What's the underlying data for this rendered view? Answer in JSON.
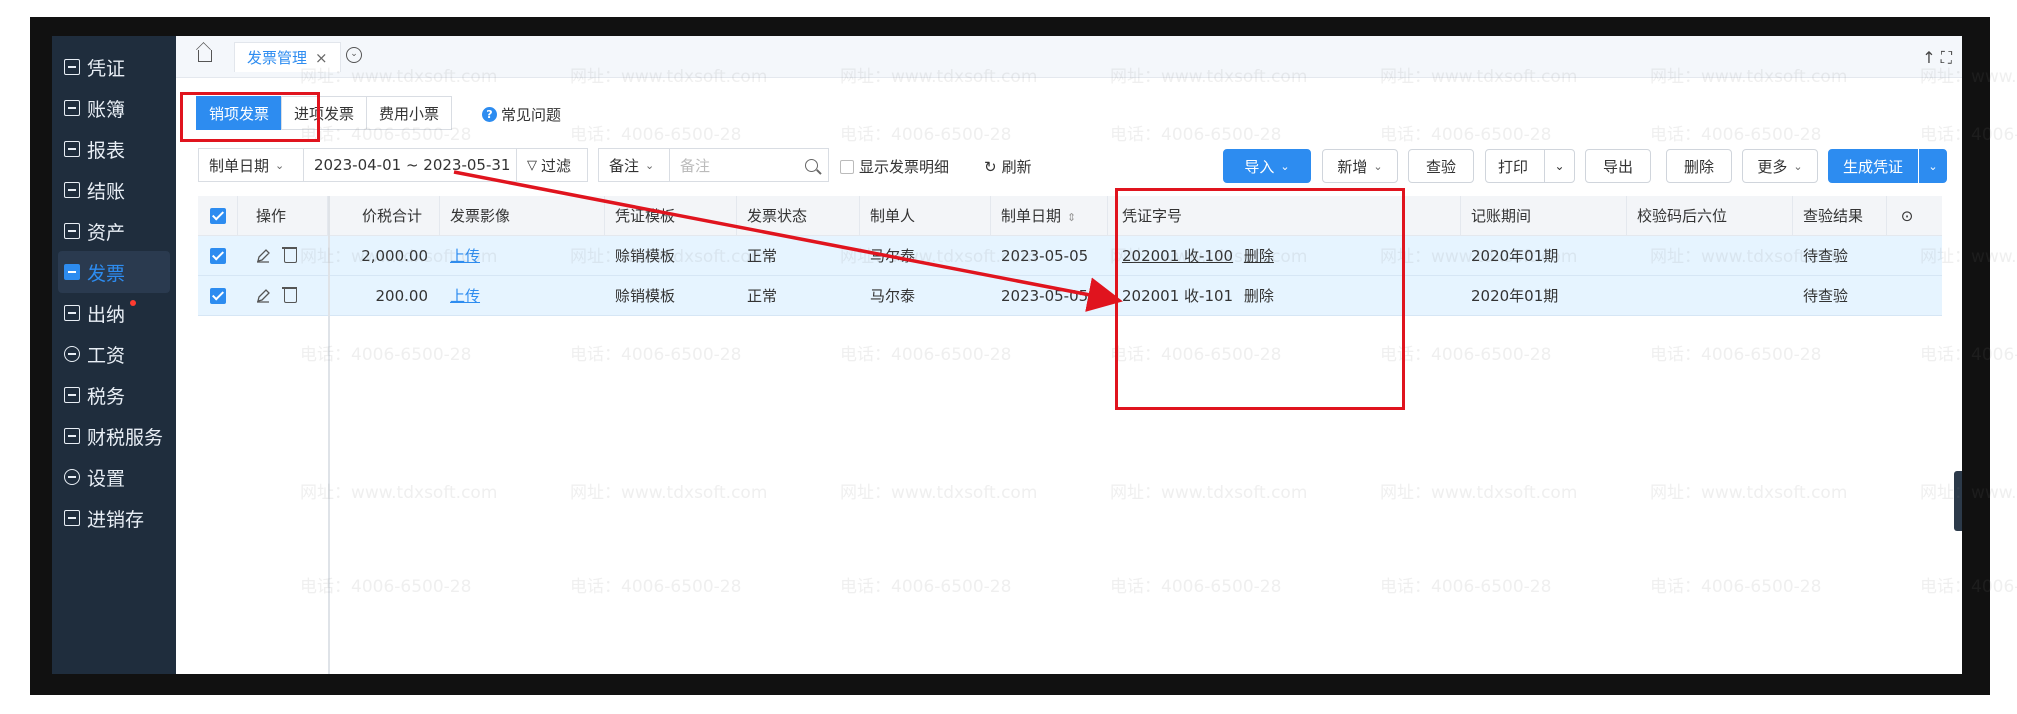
{
  "sidebar": {
    "items": [
      {
        "label": "凭证",
        "icon": "voucher-icon"
      },
      {
        "label": "账簿",
        "icon": "ledger-icon"
      },
      {
        "label": "报表",
        "icon": "report-icon"
      },
      {
        "label": "结账",
        "icon": "closing-icon"
      },
      {
        "label": "资产",
        "icon": "asset-icon"
      },
      {
        "label": "发票",
        "icon": "invoice-icon",
        "active": true
      },
      {
        "label": "出纳",
        "icon": "cashier-icon",
        "badge": true
      },
      {
        "label": "工资",
        "icon": "salary-icon"
      },
      {
        "label": "税务",
        "icon": "tax-icon"
      },
      {
        "label": "财税服务",
        "icon": "service-icon"
      },
      {
        "label": "设置",
        "icon": "settings-icon"
      },
      {
        "label": "进销存",
        "icon": "inventory-icon"
      }
    ]
  },
  "tabbar": {
    "active_tab": "发票管理",
    "close": "×",
    "right_icons": "↑ ⛶"
  },
  "subtabs": [
    "销项发票",
    "进项发票",
    "费用小票"
  ],
  "faq": "常见问题",
  "filters": {
    "date_type": "制单日期",
    "date_range": "2023-04-01 ~ 2023-05-31",
    "filter_label": "过滤",
    "remark_type": "备注",
    "remark_placeholder": "备注",
    "show_detail": "显示发票明细",
    "refresh": "刷新"
  },
  "toolbar": {
    "import": "导入",
    "add": "新增",
    "verify": "查验",
    "print": "打印",
    "export": "导出",
    "delete": "删除",
    "more": "更多",
    "generate": "生成凭证"
  },
  "table": {
    "columns": [
      "操作",
      "价税合计",
      "发票影像",
      "凭证模板",
      "发票状态",
      "制单人",
      "制单日期",
      "凭证字号",
      "记账期间",
      "校验码后六位",
      "查验结果"
    ],
    "rows": [
      {
        "amount": "2,000.00",
        "image": "上传",
        "template": "赊销模板",
        "status": "正常",
        "maker": "马尔泰",
        "date": "2023-05-05",
        "voucher": "202001 收-100",
        "voucher_delete": "删除",
        "period": "2020年01期",
        "check_code": "",
        "result": "待查验"
      },
      {
        "amount": "200.00",
        "image": "上传",
        "template": "赊销模板",
        "status": "正常",
        "maker": "马尔泰",
        "date": "2023-05-05",
        "voucher": "202001 收-101",
        "voucher_delete": "删除",
        "period": "2020年01期",
        "check_code": "",
        "result": "待查验"
      }
    ]
  },
  "watermark": {
    "phone": "电话：4006-6500-28",
    "site": "网址：www.tdxsoft.com"
  },
  "colors": {
    "accent": "#2d8cf0",
    "sidebar_bg": "#1f2d3d",
    "annotation": "#e0141e",
    "row_selected": "#e6f4ff"
  }
}
